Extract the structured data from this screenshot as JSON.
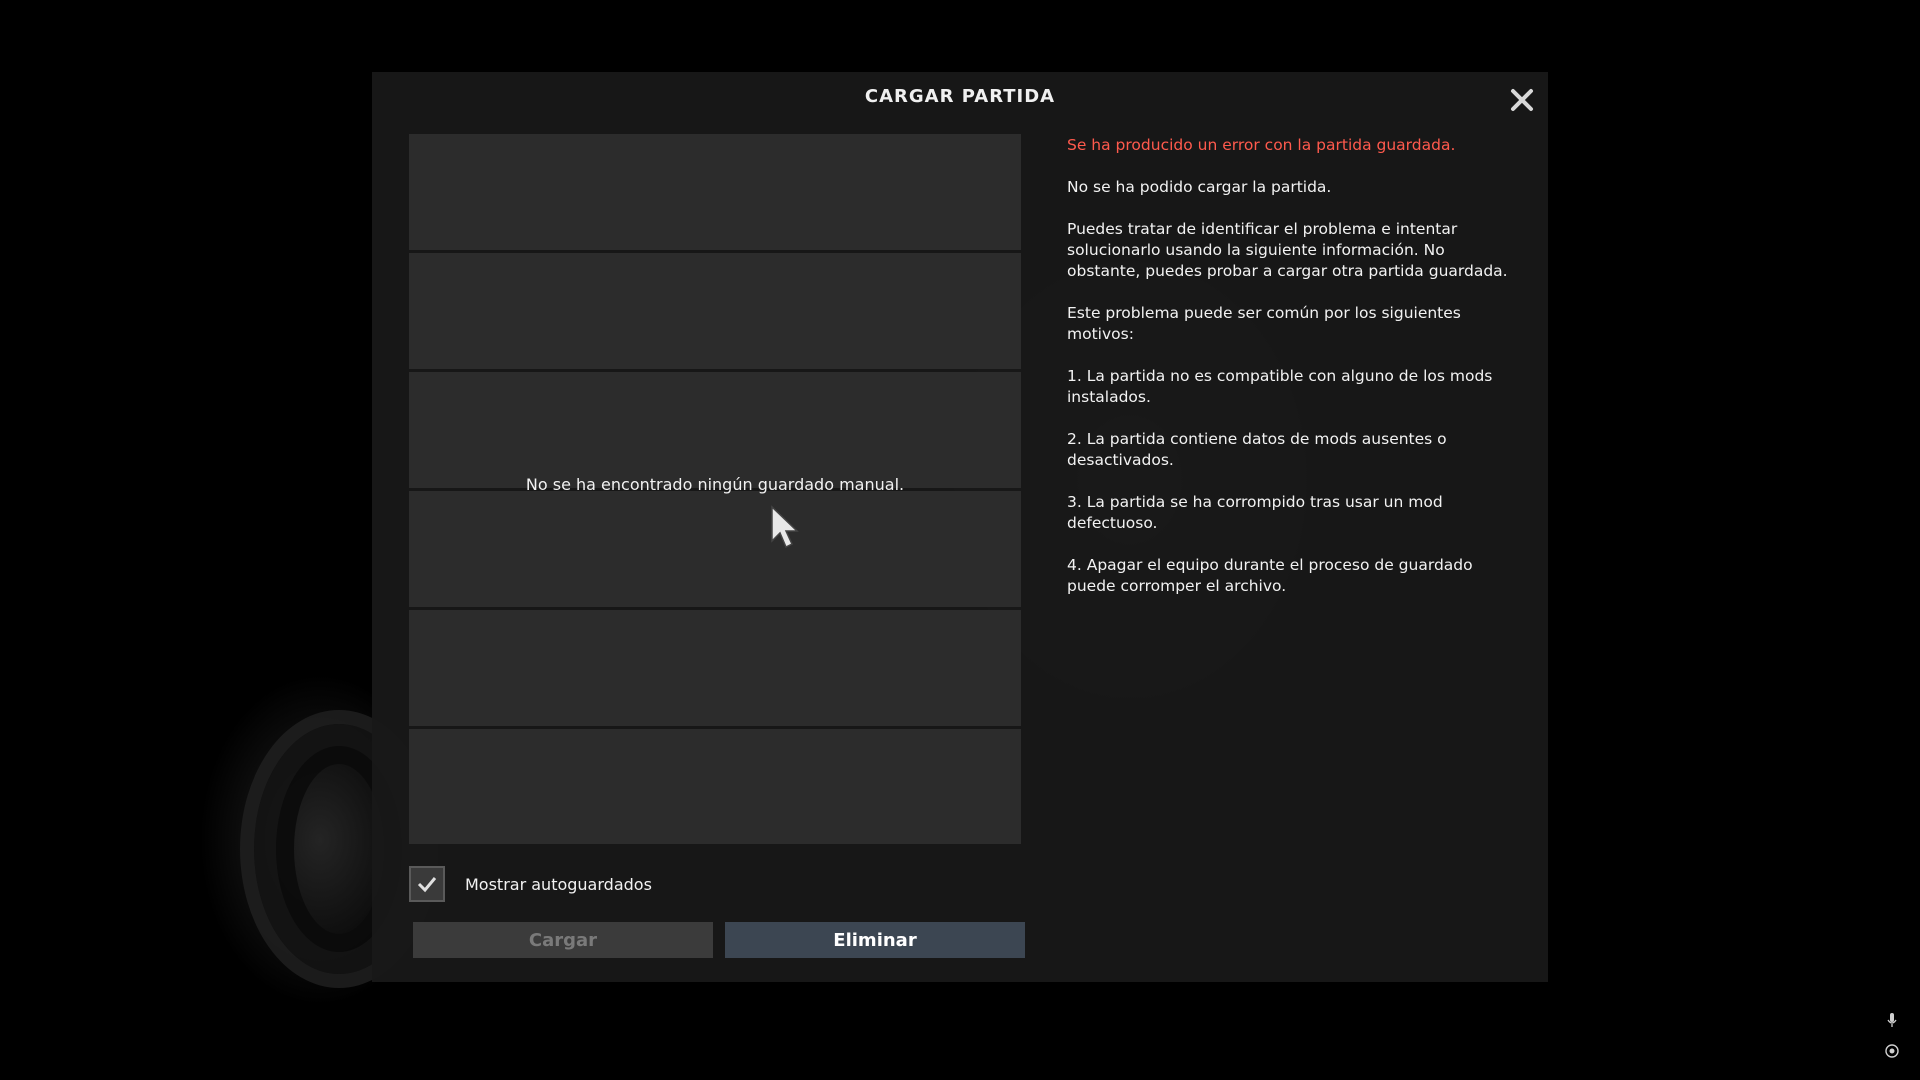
{
  "dialog": {
    "title": "CARGAR PARTIDA",
    "close_icon": "close-icon"
  },
  "slots": {
    "count": 6,
    "empty_message": "No se ha encontrado ningún guardado manual."
  },
  "info": {
    "error": "Se ha producido un error con la partida guardada.",
    "p1": "No se ha podido cargar la partida.",
    "p2": "Puedes tratar de identificar el problema e intentar solucionarlo usando la siguiente información. No obstante, puedes probar a cargar otra partida guardada.",
    "p3": "Este problema puede ser común por los siguientes motivos:",
    "r1": "1. La partida no es compatible con alguno de los mods instalados.",
    "r2": "2. La partida contiene datos de mods ausentes o desactivados.",
    "r3": "3. La partida se ha corrompido tras usar un mod defectuoso.",
    "r4": "4. Apagar el equipo durante el proceso de guardado puede corromper el archivo."
  },
  "autosave": {
    "label": "Mostrar autoguardados",
    "checked": true
  },
  "buttons": {
    "load": "Cargar",
    "delete": "Eliminar"
  },
  "colors": {
    "error": "#ff5a4d",
    "delete_button": "#3c4652",
    "load_button_disabled": "#3b3b3b"
  },
  "system_icons": [
    "microphone-icon",
    "target-icon"
  ]
}
